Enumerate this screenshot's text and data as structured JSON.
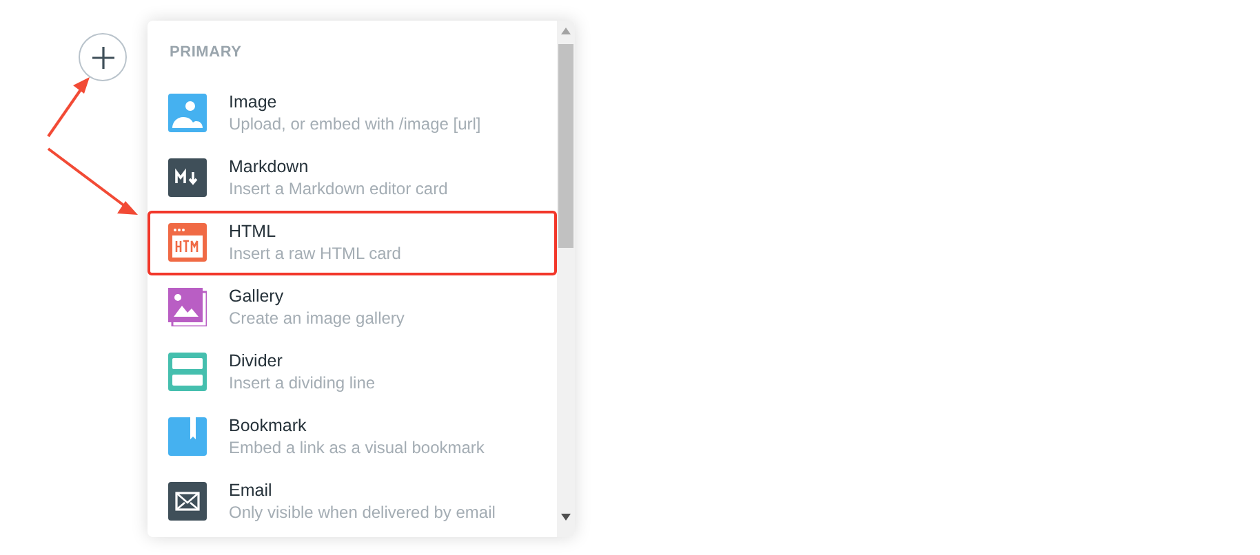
{
  "section_heading": "PRIMARY",
  "items": [
    {
      "kind": "image",
      "title": "Image",
      "description": "Upload, or embed with /image [url]",
      "highlighted": false
    },
    {
      "kind": "markdown",
      "title": "Markdown",
      "description": "Insert a Markdown editor card",
      "highlighted": false
    },
    {
      "kind": "html",
      "title": "HTML",
      "description": "Insert a raw HTML card",
      "highlighted": true
    },
    {
      "kind": "gallery",
      "title": "Gallery",
      "description": "Create an image gallery",
      "highlighted": false
    },
    {
      "kind": "divider",
      "title": "Divider",
      "description": "Insert a dividing line",
      "highlighted": false
    },
    {
      "kind": "bookmark",
      "title": "Bookmark",
      "description": "Embed a link as a visual bookmark",
      "highlighted": false
    },
    {
      "kind": "email",
      "title": "Email",
      "description": "Only visible when delivered by email",
      "highlighted": false
    }
  ]
}
